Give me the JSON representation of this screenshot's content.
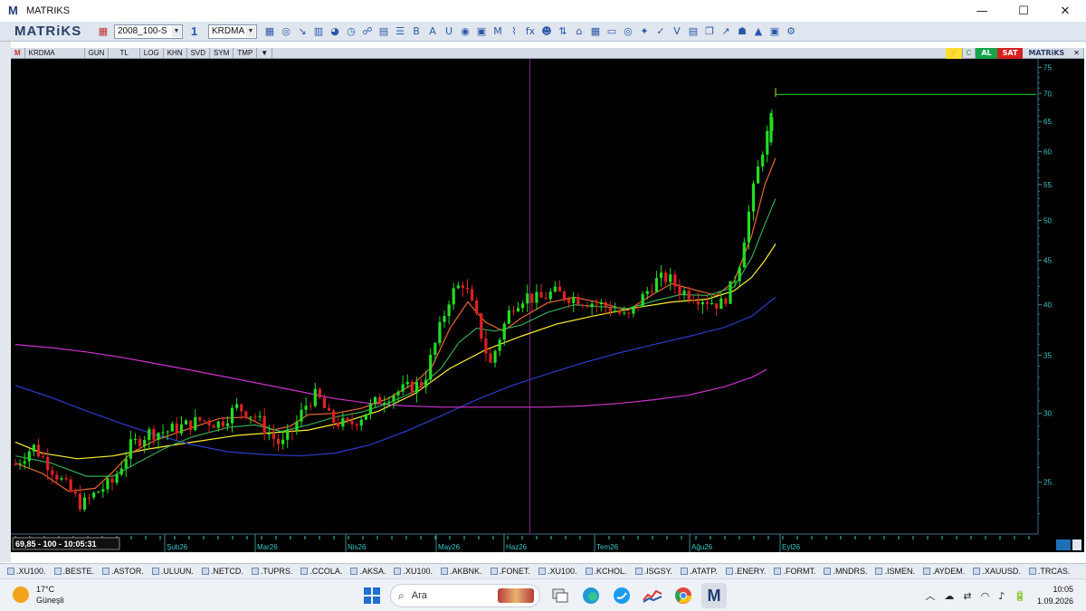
{
  "window": {
    "title": "MATRIKS",
    "logo_letter": "M",
    "minimize_glyph": "—",
    "maximize_glyph": "☐",
    "close_glyph": "✕"
  },
  "toolbar": {
    "brand": "MATRiKS",
    "workspace_value": "2008_100-S",
    "period_value": "1",
    "symbol_value": "KRDMA",
    "icons": [
      "save-icon",
      "zoom-icon",
      "cursor-icon",
      "bar-chart-icon",
      "pie-icon",
      "clock-icon",
      "handshake-icon",
      "calendar-icon",
      "list-icon",
      "bold-icon",
      "font-icon",
      "underline-icon",
      "globe-icon",
      "news-icon",
      "mail-icon",
      "line-chart-icon",
      "fx-icon",
      "users-icon",
      "sort-icon",
      "bank-icon",
      "calculator-icon",
      "folder-icon",
      "search-icon",
      "twitter-icon",
      "check-icon",
      "filter-icon",
      "print-icon",
      "copy-icon",
      "arrow-icon",
      "bell-icon",
      "alert-icon",
      "monitor-icon",
      "settings-icon"
    ],
    "icon_glyphs": [
      "▦",
      "◎",
      "↘",
      "▥",
      "◕",
      "◷",
      "☍",
      "▤",
      "☰",
      "B",
      "A",
      "U",
      "◉",
      "▣",
      "M",
      "⌇",
      "fx",
      "☻",
      "⇅",
      "⌂",
      "▦",
      "▭",
      "◎",
      "✦",
      "✓",
      "V",
      "▤",
      "❐",
      "↗",
      "☗",
      "▲",
      "▣",
      "⚙"
    ]
  },
  "chart_header": {
    "symbol": "KRDMA",
    "buttons": [
      "GUN",
      "TL",
      "LOG",
      "KHN",
      "SVD",
      "SYM",
      "TMP"
    ],
    "buy_label": "AL",
    "sell_label": "SAT",
    "brand": "MATRiKS"
  },
  "chart_data": {
    "type": "candlestick",
    "symbol": "KRDMA",
    "scale": "log",
    "ylim": [
      22,
      76
    ],
    "y_ticks": [
      "75.",
      "70.",
      "65.",
      "60.",
      "55.",
      "50.",
      "45.",
      "40.",
      "35.",
      "30.",
      "25."
    ],
    "y_tick_values": [
      75,
      70,
      65,
      60,
      55,
      50,
      45,
      40,
      35,
      30,
      25
    ],
    "x_tick_labels": [
      "Şub26",
      "Mar26",
      "Nis26",
      "May26",
      "Haz26",
      "Tem26",
      "Ağu26",
      "Eyl26"
    ],
    "status_box": "69,85 - 100 - 10:05:31",
    "last_price": 69.85,
    "up_color": "#22dd22",
    "down_color": "#dd2222",
    "moving_averages": [
      {
        "color": "#ffee33",
        "points": [
          [
            0,
            27.8
          ],
          [
            30,
            27
          ],
          [
            70,
            26.6
          ],
          [
            110,
            26.8
          ],
          [
            150,
            27.3
          ],
          [
            200,
            27.8
          ],
          [
            250,
            28.3
          ],
          [
            290,
            28.5
          ],
          [
            330,
            28.7
          ],
          [
            370,
            29.3
          ],
          [
            410,
            30.2
          ],
          [
            450,
            31.6
          ],
          [
            490,
            33.8
          ],
          [
            530,
            35.5
          ],
          [
            570,
            36.8
          ],
          [
            610,
            38
          ],
          [
            650,
            38.8
          ],
          [
            700,
            39.7
          ],
          [
            740,
            40.3
          ],
          [
            780,
            40.6
          ],
          [
            810,
            41.5
          ],
          [
            830,
            43
          ],
          [
            845,
            45
          ],
          [
            857,
            47
          ]
        ]
      },
      {
        "color": "#2a3cc8",
        "points": [
          [
            0,
            32.3
          ],
          [
            40,
            31.3
          ],
          [
            80,
            30.2
          ],
          [
            120,
            29.2
          ],
          [
            160,
            28.3
          ],
          [
            200,
            27.6
          ],
          [
            240,
            27.1
          ],
          [
            280,
            26.9
          ],
          [
            320,
            26.8
          ],
          [
            360,
            27
          ],
          [
            400,
            27.6
          ],
          [
            440,
            28.6
          ],
          [
            480,
            29.8
          ],
          [
            520,
            31.1
          ],
          [
            560,
            32.3
          ],
          [
            600,
            33.3
          ],
          [
            640,
            34.3
          ],
          [
            680,
            35.2
          ],
          [
            720,
            36
          ],
          [
            760,
            36.8
          ],
          [
            800,
            37.7
          ],
          [
            830,
            38.8
          ],
          [
            857,
            40.8
          ]
        ]
      },
      {
        "color": "#cc33cc",
        "points": [
          [
            0,
            36
          ],
          [
            40,
            35.7
          ],
          [
            80,
            35.3
          ],
          [
            120,
            34.8
          ],
          [
            160,
            34.2
          ],
          [
            200,
            33.6
          ],
          [
            240,
            33
          ],
          [
            280,
            32.4
          ],
          [
            320,
            31.8
          ],
          [
            360,
            31.2
          ],
          [
            400,
            30.8
          ],
          [
            440,
            30.6
          ],
          [
            480,
            30.5
          ],
          [
            520,
            30.5
          ],
          [
            560,
            30.5
          ],
          [
            600,
            30.5
          ],
          [
            640,
            30.6
          ],
          [
            680,
            30.8
          ],
          [
            720,
            31.1
          ],
          [
            760,
            31.5
          ],
          [
            800,
            32.2
          ],
          [
            830,
            33
          ],
          [
            847,
            33.7
          ]
        ]
      },
      {
        "color": "#ee6633",
        "points": [
          [
            0,
            26.3
          ],
          [
            30,
            25.6
          ],
          [
            60,
            24.4
          ],
          [
            90,
            24.6
          ],
          [
            110,
            25.7
          ],
          [
            130,
            27
          ],
          [
            160,
            28
          ],
          [
            200,
            28.9
          ],
          [
            230,
            29.6
          ],
          [
            260,
            29.7
          ],
          [
            290,
            28.7
          ],
          [
            310,
            29
          ],
          [
            330,
            29.9
          ],
          [
            360,
            30
          ],
          [
            390,
            30.4
          ],
          [
            420,
            31.2
          ],
          [
            450,
            32.5
          ],
          [
            470,
            34
          ],
          [
            490,
            37.6
          ],
          [
            510,
            40.3
          ],
          [
            530,
            38.2
          ],
          [
            550,
            37.3
          ],
          [
            570,
            38.6
          ],
          [
            600,
            40.2
          ],
          [
            630,
            40.8
          ],
          [
            660,
            40.2
          ],
          [
            690,
            39.4
          ],
          [
            720,
            41.2
          ],
          [
            740,
            42.3
          ],
          [
            770,
            41.5
          ],
          [
            790,
            41
          ],
          [
            810,
            42.5
          ],
          [
            830,
            48
          ],
          [
            845,
            55
          ],
          [
            857,
            59
          ]
        ]
      },
      {
        "color": "#33aa55",
        "points": [
          [
            0,
            26.8
          ],
          [
            40,
            26.3
          ],
          [
            80,
            25.4
          ],
          [
            110,
            25.4
          ],
          [
            140,
            26.4
          ],
          [
            170,
            27.4
          ],
          [
            200,
            28.2
          ],
          [
            240,
            28.9
          ],
          [
            270,
            29.1
          ],
          [
            300,
            28.6
          ],
          [
            330,
            29.1
          ],
          [
            360,
            29.7
          ],
          [
            390,
            30.1
          ],
          [
            420,
            30.8
          ],
          [
            450,
            31.8
          ],
          [
            480,
            33.8
          ],
          [
            500,
            36.2
          ],
          [
            520,
            37.6
          ],
          [
            540,
            37.3
          ],
          [
            570,
            37.9
          ],
          [
            600,
            39.2
          ],
          [
            630,
            40
          ],
          [
            660,
            39.8
          ],
          [
            690,
            39.6
          ],
          [
            720,
            40.4
          ],
          [
            750,
            41.1
          ],
          [
            780,
            41
          ],
          [
            810,
            41.9
          ],
          [
            830,
            45.3
          ],
          [
            845,
            49.5
          ],
          [
            857,
            53
          ]
        ]
      }
    ],
    "price_path": [
      [
        0,
        26.2
      ],
      [
        20,
        27.5
      ],
      [
        40,
        26
      ],
      [
        60,
        24.5
      ],
      [
        75,
        23.5
      ],
      [
        95,
        24.5
      ],
      [
        110,
        25
      ],
      [
        130,
        27.5
      ],
      [
        150,
        28.5
      ],
      [
        170,
        28.6
      ],
      [
        190,
        29
      ],
      [
        210,
        29.5
      ],
      [
        230,
        29.2
      ],
      [
        250,
        30.5
      ],
      [
        270,
        29.8
      ],
      [
        285,
        28.5
      ],
      [
        300,
        27.5
      ],
      [
        315,
        29
      ],
      [
        330,
        31
      ],
      [
        340,
        31.5
      ],
      [
        355,
        29.5
      ],
      [
        375,
        29
      ],
      [
        390,
        29.8
      ],
      [
        405,
        30.8
      ],
      [
        420,
        31.5
      ],
      [
        440,
        32
      ],
      [
        460,
        32.5
      ],
      [
        475,
        36.5
      ],
      [
        490,
        41
      ],
      [
        505,
        42.5
      ],
      [
        520,
        38.5
      ],
      [
        535,
        34
      ],
      [
        545,
        36.5
      ],
      [
        560,
        40
      ],
      [
        575,
        41
      ],
      [
        590,
        40.5
      ],
      [
        605,
        41.3
      ],
      [
        620,
        41
      ],
      [
        640,
        40.5
      ],
      [
        660,
        40
      ],
      [
        675,
        39.5
      ],
      [
        690,
        38.5
      ],
      [
        705,
        40.5
      ],
      [
        720,
        42.5
      ],
      [
        735,
        43
      ],
      [
        750,
        41.5
      ],
      [
        765,
        41
      ],
      [
        780,
        40.5
      ],
      [
        795,
        40
      ],
      [
        805,
        41.5
      ],
      [
        815,
        44
      ],
      [
        825,
        50
      ],
      [
        835,
        56
      ],
      [
        845,
        62
      ],
      [
        852,
        64
      ],
      [
        857,
        67
      ]
    ]
  },
  "symbol_tabs": [
    ".XU100.",
    ".BESTE.",
    ".ASTOR.",
    ".ULUUN.",
    ".NETCD.",
    ".TUPRS.",
    ".CCOLA.",
    ".AKSA.",
    ".XU100.",
    ".AKBNK.",
    ".FONET.",
    ".XU100.",
    ".KCHOL.",
    ".ISGSY.",
    ".ATATP.",
    ".ENERY.",
    ".FORMT.",
    ".MNDRS.",
    ".ISMEN.",
    ".AYDEM.",
    ".XAUUSD.",
    ".TRCAS."
  ],
  "taskbar": {
    "temperature": "17°C",
    "weather_label": "Güneşli",
    "search_placeholder": "Ara",
    "time": "10:05",
    "date": "1.09.2026",
    "tray_glyphs": [
      "︿",
      "☁",
      "⇄",
      "◠",
      "♪",
      "🔋"
    ]
  }
}
